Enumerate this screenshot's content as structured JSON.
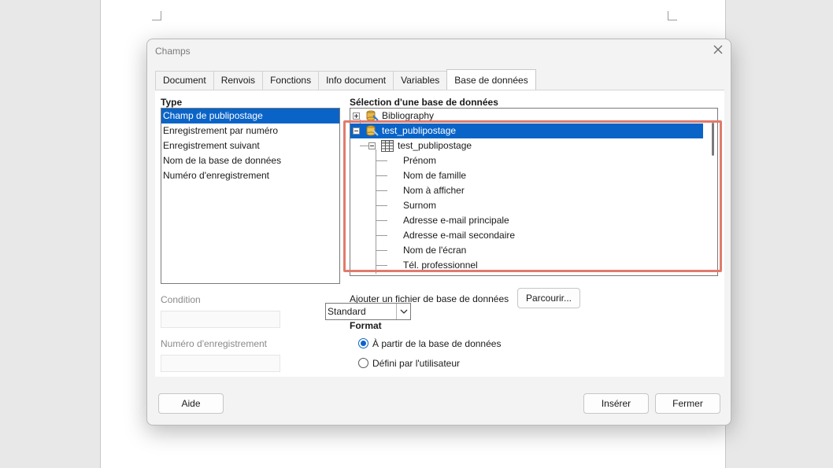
{
  "dialog": {
    "title": "Champs",
    "tabs": [
      "Document",
      "Renvois",
      "Fonctions",
      "Info document",
      "Variables",
      "Base de données"
    ],
    "active_tab": "Base de données"
  },
  "type_section": {
    "heading": "Type",
    "items": [
      "Champ de publipostage",
      "Enregistrement par numéro",
      "Enregistrement suivant",
      "Nom de la base de données",
      "Numéro d'enregistrement"
    ],
    "selected_index": 0
  },
  "condition": {
    "label": "Condition",
    "value": ""
  },
  "record_number": {
    "label": "Numéro d'enregistrement",
    "value": ""
  },
  "db_selection": {
    "heading": "Sélection d'une base de données",
    "tree": {
      "bibliography": "Bibliography",
      "database": "test_publipostage",
      "table": "test_publipostage",
      "fields": [
        "Prénom",
        "Nom de famille",
        "Nom à afficher",
        "Surnom",
        "Adresse e-mail principale",
        "Adresse e-mail secondaire",
        "Nom de l'écran",
        "Tél. professionnel"
      ]
    }
  },
  "add_db": {
    "label": "Ajouter un fichier de base de données",
    "button": "Parcourir..."
  },
  "format": {
    "heading": "Format",
    "option_db": "À partir de la base de données",
    "option_user": "Défini par l'utilisateur",
    "selected": "option_db",
    "user_format_value": "Standard"
  },
  "buttons": {
    "help": "Aide",
    "insert": "Insérer",
    "close": "Fermer"
  },
  "colors": {
    "selection": "#0a64c8",
    "highlight_box": "#e07b6c"
  }
}
